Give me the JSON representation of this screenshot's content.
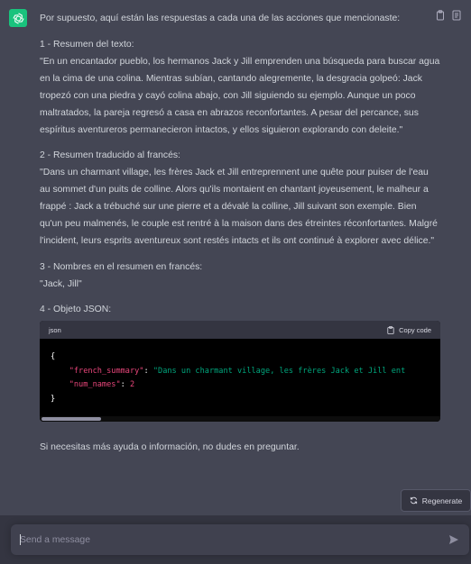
{
  "colors": {
    "background": "#444654",
    "avatar": "#19c37d",
    "code_bg": "#000000",
    "code_header": "#343541",
    "json_key": "#e9467b",
    "json_string": "#00a67d",
    "footer": "#343541",
    "input": "#40414f"
  },
  "message": {
    "intro": "Por supuesto, aquí están las respuestas a cada una de las acciones que mencionaste:",
    "s1_title": "1 - Resumen del texto:",
    "s1_body": "\"En un encantador pueblo, los hermanos Jack y Jill emprenden una búsqueda para buscar agua en la cima de una colina. Mientras subían, cantando alegremente, la desgracia golpeó: Jack tropezó con una piedra y cayó colina abajo, con Jill siguiendo su ejemplo. Aunque un poco maltratados, la pareja regresó a casa en abrazos reconfortantes. A pesar del percance, sus espíritus aventureros permanecieron intactos, y ellos siguieron explorando con deleite.\"",
    "s2_title": "2 - Resumen traducido al francés:",
    "s2_body": "\"Dans un charmant village, les frères Jack et Jill entreprennent une quête pour puiser de l'eau au sommet d'un puits de colline. Alors qu'ils montaient en chantant joyeusement, le malheur a frappé : Jack a trébuché sur une pierre et a dévalé la colline, Jill suivant son exemple. Bien qu'un peu malmenés, le couple est rentré à la maison dans des étreintes réconfortantes. Malgré l'incident, leurs esprits aventureux sont restés intacts et ils ont continué à explorer avec délice.\"",
    "s3_title": "3 - Nombres en el resumen en francés:",
    "s3_body": "\"Jack, Jill\"",
    "s4_title": "4 - Objeto JSON:",
    "closing": "Si necesitas más ayuda o información, no dudes en preguntar."
  },
  "code_block": {
    "language": "json",
    "copy_label": "Copy code",
    "open_brace": "{",
    "close_brace": "}",
    "key1": "\"french_summary\"",
    "val1": "\"Dans un charmant village, les frères Jack et Jill ent",
    "key2": "\"num_names\"",
    "val2": "2",
    "colon": ": ",
    "comma": ","
  },
  "regenerate_label": "Regenerate",
  "input": {
    "placeholder": "Send a message"
  },
  "icons": {
    "avatar": "openai-logo-icon",
    "copy": "clipboard-icon",
    "thumbs": "thumbs-down-icon",
    "regenerate": "refresh-icon",
    "send": "send-icon"
  }
}
